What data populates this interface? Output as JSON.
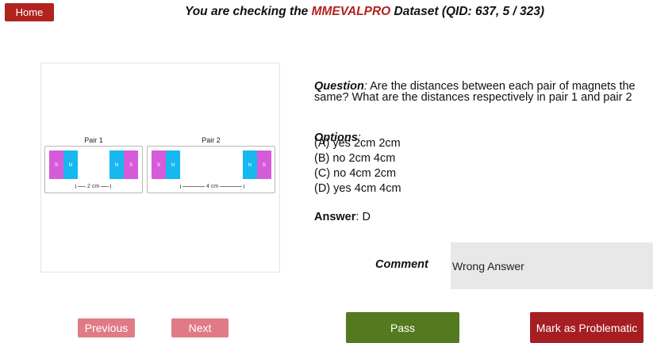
{
  "home_label": "Home",
  "header": {
    "prefix": "You are checking the ",
    "dataset": "MMEVALPRO",
    "suffix": " Dataset (QID: 637, 5 / 323)"
  },
  "figure": {
    "pair1": {
      "title": "Pair 1",
      "distance": "2 cm",
      "magnets": [
        "S",
        "N",
        "N",
        "S"
      ]
    },
    "pair2": {
      "title": "Pair 2",
      "distance": "4 cm",
      "magnets": [
        "S",
        "N",
        "N",
        "S"
      ]
    },
    "colors": {
      "pink": "#d65ad9",
      "cyan": "#17b7ef"
    }
  },
  "question": {
    "label": "Question",
    "line1": " Are the distances between each pair of magnets the",
    "line2": "same? What are the distances respectively in pair 1 and pair 2"
  },
  "options": {
    "label": "Options",
    "items": [
      "(A) yes 2cm 2cm",
      "(B) no 2cm 4cm",
      "(C) no 4cm 2cm",
      "(D) yes 4cm 4cm"
    ]
  },
  "answer": {
    "label": "Answer",
    "value": ": D"
  },
  "comment": {
    "label": "Comment",
    "value": "Wrong Answer"
  },
  "buttons": {
    "previous": "Previous",
    "next": "Next",
    "pass": "Pass",
    "problematic": "Mark as Problematic"
  }
}
